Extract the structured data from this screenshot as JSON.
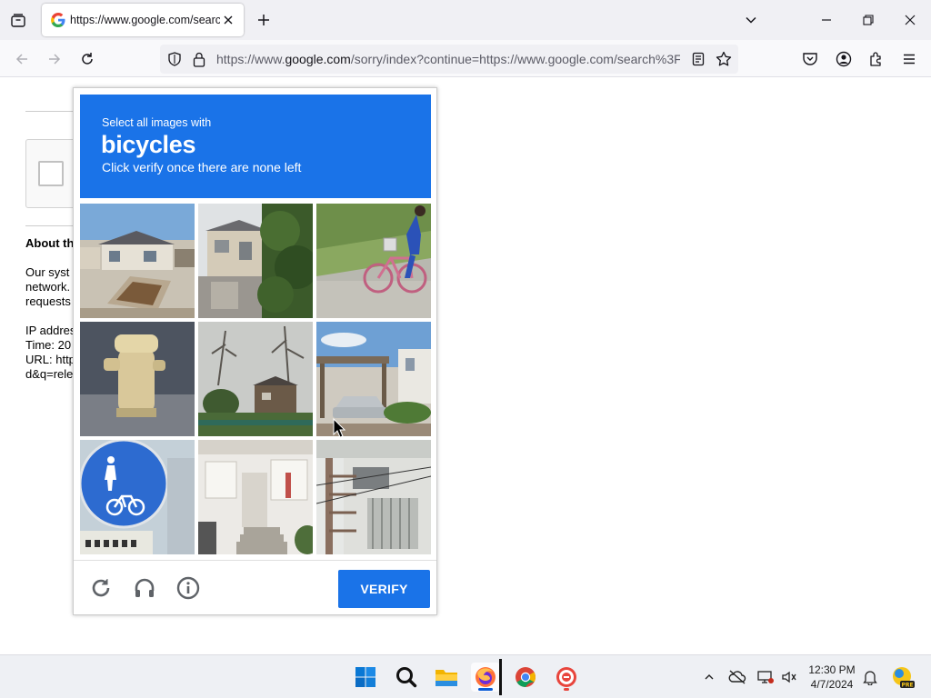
{
  "browser": {
    "tab_title": "https://www.google.com/search",
    "url_prefix": "https://www.",
    "url_domain": "google.com",
    "url_rest": "/sorry/index?continue=https://www.google.com/search%3F"
  },
  "page": {
    "about_heading": "About th",
    "lines": [
      "Our syst",
      "network.",
      "requests",
      "IP addres",
      "Time: 20",
      "URL: http",
      "d&q=rele"
    ]
  },
  "captcha": {
    "instruction_line1": "Select all images with",
    "target": "bicycles",
    "instruction_line3": "Click verify once there are none left",
    "verify_label": "VERIFY",
    "tiles": [
      {
        "id": 1,
        "content": "house-with-garden"
      },
      {
        "id": 2,
        "content": "houses-with-tree"
      },
      {
        "id": 3,
        "content": "person-riding-bicycle"
      },
      {
        "id": 4,
        "content": "fire-hydrant"
      },
      {
        "id": 5,
        "content": "house-with-trees"
      },
      {
        "id": 6,
        "content": "car-in-carport"
      },
      {
        "id": 7,
        "content": "bicycle-road-sign"
      },
      {
        "id": 8,
        "content": "house-entrance"
      },
      {
        "id": 9,
        "content": "building-with-pipes"
      }
    ]
  },
  "taskbar": {
    "time": "12:30 PM",
    "date": "4/7/2024",
    "apps": [
      "start",
      "search",
      "file-explorer",
      "firefox",
      "chrome",
      "app-red"
    ]
  },
  "colors": {
    "captcha_blue": "#1a73e8",
    "chrome_bg": "#f0f0f4"
  }
}
